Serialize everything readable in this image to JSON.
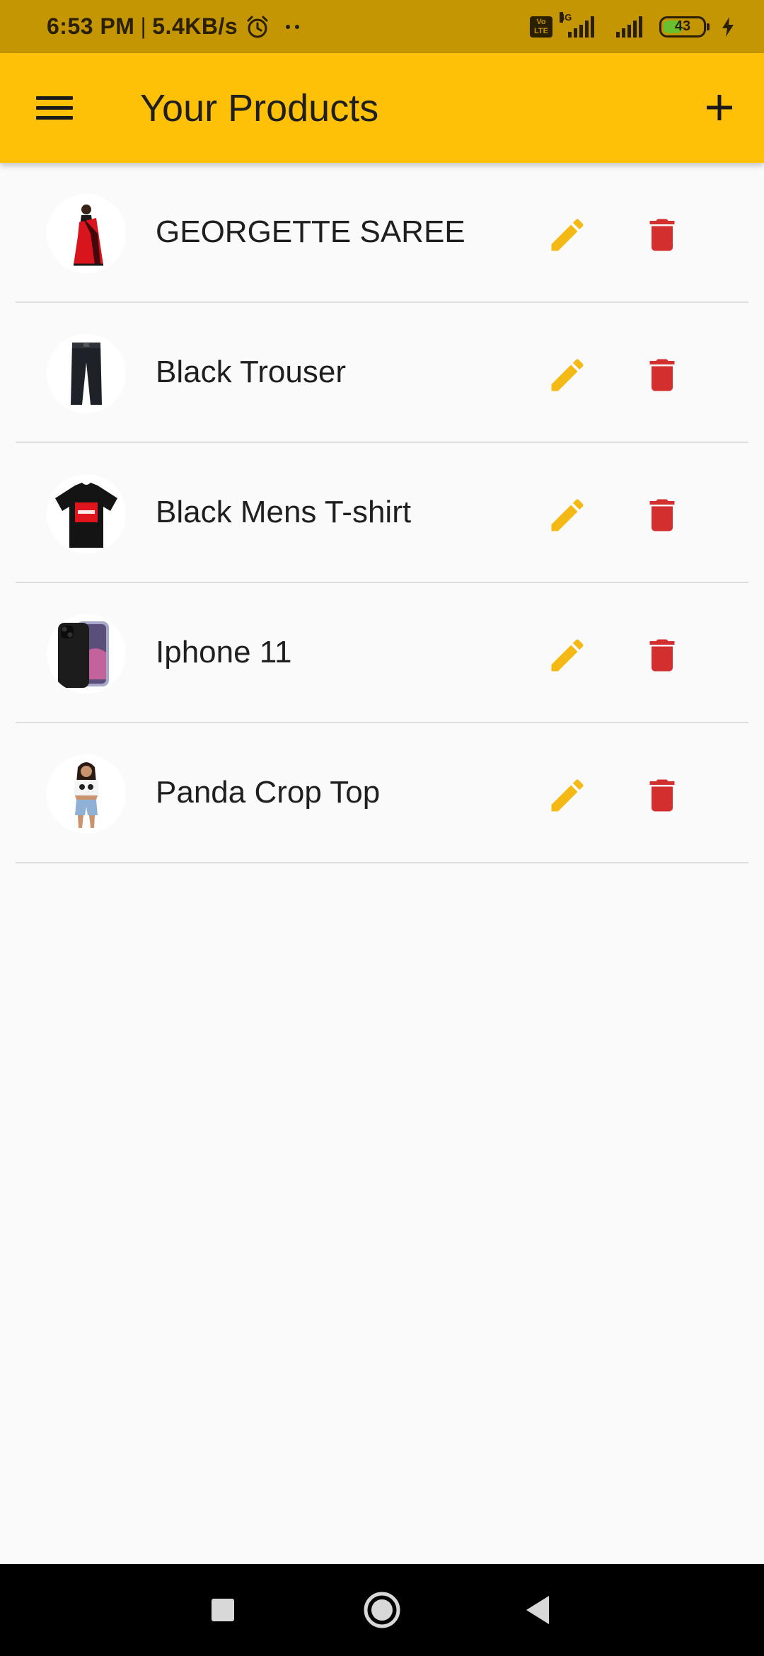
{
  "status_bar": {
    "time": "6:53 PM",
    "separator": "|",
    "speed": "5.4KB/s",
    "volte_top": "Vo",
    "volte_bottom": "LTE",
    "network": "4G",
    "battery": "43"
  },
  "app_bar": {
    "title": "Your Products",
    "menu_icon": "menu-icon",
    "add_icon": "plus-icon",
    "color": "#ffc107"
  },
  "products": [
    {
      "name": "GEORGETTE SAREE",
      "image": "saree-image"
    },
    {
      "name": "Black Trouser",
      "image": "trouser-image"
    },
    {
      "name": "Black Mens T-shirt",
      "image": "tshirt-image"
    },
    {
      "name": "Iphone 11",
      "image": "phone-image"
    },
    {
      "name": "Panda Crop Top",
      "image": "croptop-image"
    }
  ],
  "actions": {
    "edit_icon": "pencil-icon",
    "edit_color": "#f5b916",
    "delete_icon": "trash-icon",
    "delete_color": "#d32f2f"
  },
  "nav_bar": {
    "recents_icon": "square-icon",
    "home_icon": "circle-icon",
    "back_icon": "triangle-back-icon"
  }
}
